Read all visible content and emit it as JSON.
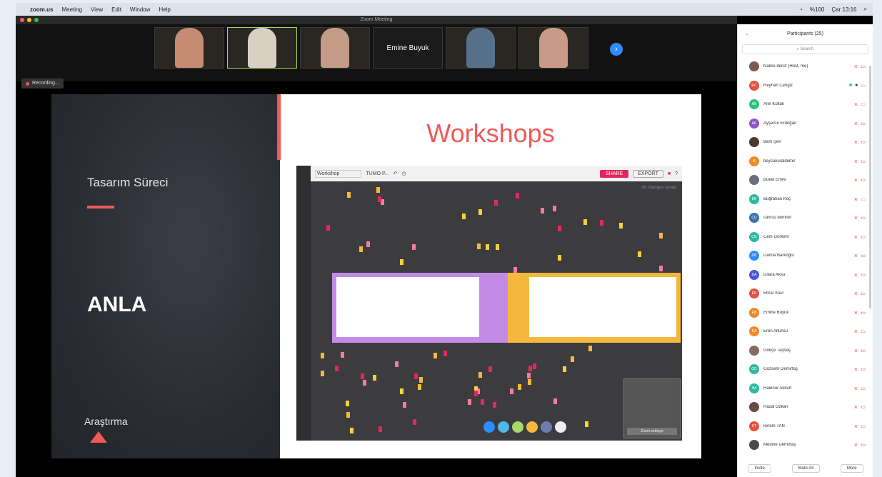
{
  "menubar": {
    "apple": "",
    "app": "zoom.us",
    "items": [
      "Meeting",
      "View",
      "Edit",
      "Window",
      "Help"
    ],
    "clock": "Çar 13:16",
    "battery": "%100"
  },
  "window": {
    "title": "Zoom Meeting"
  },
  "video_strip": {
    "tiles": [
      {
        "label": "",
        "color": "#c58c73"
      },
      {
        "label": "",
        "color": "#d9d0c3"
      },
      {
        "label": "",
        "color": "#c39b86"
      },
      {
        "label": "Emine Buyuk",
        "color": "#1b1b1b"
      },
      {
        "label": "",
        "color": "#56708a"
      },
      {
        "label": "",
        "color": "#c99a86"
      }
    ],
    "next": "›"
  },
  "recording": {
    "label": "Recording..."
  },
  "slide": {
    "subtitle": "Tasarım Süreci",
    "heading": "ANLA",
    "footer": "Araştırma",
    "title": "Workshops",
    "accent": "#ef5a57"
  },
  "mural": {
    "board_name": "Workshop",
    "board_label": "TUMO P...",
    "share": "SHARE",
    "export": "EXPORT",
    "saved": "All changes saved",
    "minimap_btn": "Zoom settings"
  },
  "participants": {
    "title": "Participants (25)",
    "search_placeholder": "Search",
    "list": [
      {
        "name": "Nalice deniz (Host, me)",
        "initials": "",
        "color": "#7a5c4f",
        "state": "host"
      },
      {
        "name": "Reyhan Cengiz",
        "initials": "RC",
        "color": "#e4523f",
        "state": "video"
      },
      {
        "name": "Arel Koltuk",
        "initials": "AK",
        "color": "#2ec27e",
        "state": "mic"
      },
      {
        "name": "Ayşenur Erdoğan",
        "initials": "AE",
        "color": "#8f54c8",
        "state": "muted"
      },
      {
        "name": "Berk Şen",
        "initials": "",
        "color": "#4a3a2e",
        "state": "muted"
      },
      {
        "name": "beycanuraldemir",
        "initials": "B",
        "color": "#f08a28",
        "state": "muted"
      },
      {
        "name": "Buket Emre",
        "initials": "",
        "color": "#6c6f7a",
        "state": "muted"
      },
      {
        "name": "Buğrahan Koç",
        "initials": "BK",
        "color": "#2eb8a0",
        "state": "mic"
      },
      {
        "name": "camsu demirel",
        "initials": "CD",
        "color": "#3a6fb0",
        "state": "muted"
      },
      {
        "name": "Cem Görkem",
        "initials": "CG",
        "color": "#2eb8a0",
        "state": "muted"
      },
      {
        "name": "Damla Barkoğlu",
        "initials": "DB",
        "color": "#2d8cff",
        "state": "muted"
      },
      {
        "name": "Dilara Aksu",
        "initials": "DA",
        "color": "#4a5ad0",
        "state": "muted"
      },
      {
        "name": "Ebrar Kavi",
        "initials": "EK",
        "color": "#e4523f",
        "state": "muted"
      },
      {
        "name": "Emine Buyuk",
        "initials": "EB",
        "color": "#f08a28",
        "state": "muted"
      },
      {
        "name": "Eren Altunsu",
        "initials": "EA",
        "color": "#f08a28",
        "state": "muted"
      },
      {
        "name": "Gökçe Taşbaş",
        "initials": "",
        "color": "#8a6a5e",
        "state": "muted"
      },
      {
        "name": "Gözsem Demirtaş",
        "initials": "GD",
        "color": "#2eb8a0",
        "state": "muted"
      },
      {
        "name": "Halenur Akkurt",
        "initials": "HA",
        "color": "#2eb8a0",
        "state": "muted"
      },
      {
        "name": "Hazal Özkan",
        "initials": "",
        "color": "#6a4c3e",
        "state": "muted"
      },
      {
        "name": "kerem TAN",
        "initials": "KT",
        "color": "#e4523f",
        "state": "muted"
      },
      {
        "name": "Medine Demirtaş",
        "initials": "",
        "color": "#4a4a4a",
        "state": "muted"
      }
    ],
    "invite": "Invite",
    "mute_all": "Mute All",
    "more": "More"
  }
}
